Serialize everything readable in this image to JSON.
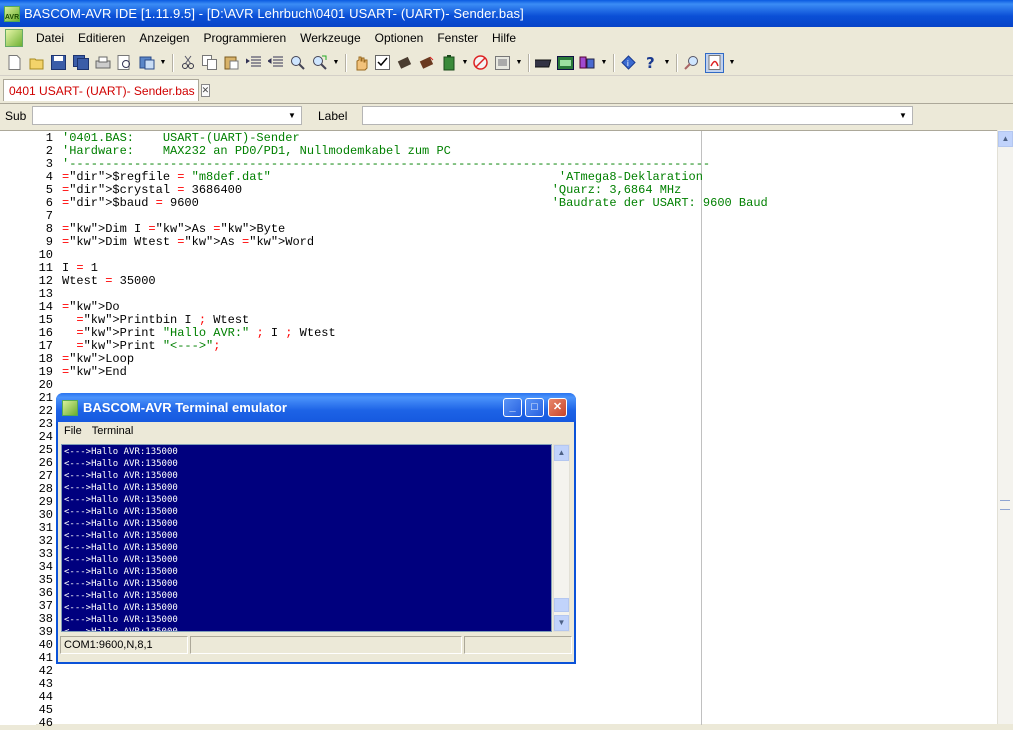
{
  "window": {
    "title": "BASCOM-AVR IDE [1.11.9.5] - [D:\\AVR Lehrbuch\\0401 USART- (UART)- Sender.bas]",
    "app_icon_text": "AVR"
  },
  "menu": [
    "Datei",
    "Editieren",
    "Anzeigen",
    "Programmieren",
    "Werkzeuge",
    "Optionen",
    "Fenster",
    "Hilfe"
  ],
  "toolbar": [
    "new-file-icon",
    "open-file-icon",
    "save-icon",
    "save-all-icon",
    "print-icon",
    "print-preview-icon",
    "compile-icon",
    "dropdown",
    "cut-icon",
    "copy-icon",
    "paste-icon",
    "indent-icon",
    "unindent-icon",
    "find-icon",
    "find-next-icon",
    "dropdown",
    "hand-icon",
    "check-syntax-icon",
    "chip-icon",
    "program-chip-icon",
    "battery-icon",
    "dropdown",
    "stop-icon",
    "simulator-icon",
    "dropdown",
    "lcd-designer-icon",
    "lcd-icon",
    "terminal-icon",
    "dropdown",
    "info-icon",
    "help-icon",
    "dropdown",
    "zoom-icon",
    "pdf-icon",
    "dropdown"
  ],
  "tabs": [
    {
      "label": "0401 USART- (UART)- Sender.bas",
      "active": true
    }
  ],
  "subrow": {
    "sub_label": "Sub",
    "label_label": "Label"
  },
  "code": [
    {
      "n": "1",
      "text": "'0401.BAS:    USART-(UART)-Sender"
    },
    {
      "n": "2",
      "text": "'Hardware:    MAX232 an PD0/PD1, Nullmodemkabel zum PC"
    },
    {
      "n": "3",
      "text": "'-----------------------------------------------------------------------------------------"
    },
    {
      "n": "4",
      "text": "$regfile = \"m8def.dat\"                                        'ATmega8-Deklaration"
    },
    {
      "n": "5",
      "text": "$crystal = 3686400                                           'Quarz: 3,6864 MHz"
    },
    {
      "n": "6",
      "text": "$baud = 9600                                                 'Baudrate der USART: 9600 Baud"
    },
    {
      "n": "7",
      "text": ""
    },
    {
      "n": "8",
      "text": "Dim I As Byte"
    },
    {
      "n": "9",
      "text": "Dim Wtest As Word"
    },
    {
      "n": "10",
      "text": ""
    },
    {
      "n": "11",
      "text": "I = 1"
    },
    {
      "n": "12",
      "text": "Wtest = 35000"
    },
    {
      "n": "13",
      "text": ""
    },
    {
      "n": "14",
      "text": "Do"
    },
    {
      "n": "15",
      "text": "  Printbin I ; Wtest"
    },
    {
      "n": "16",
      "text": "  Print \"Hallo AVR:\" ; I ; Wtest"
    },
    {
      "n": "17",
      "text": "  Print \"<--->\";"
    },
    {
      "n": "18",
      "text": "Loop"
    },
    {
      "n": "19",
      "text": "End"
    },
    {
      "n": "20",
      "text": ""
    },
    {
      "n": "21",
      "text": ""
    },
    {
      "n": "22",
      "text": ""
    },
    {
      "n": "23",
      "text": ""
    },
    {
      "n": "24",
      "text": ""
    },
    {
      "n": "25",
      "text": ""
    },
    {
      "n": "26",
      "text": ""
    },
    {
      "n": "27",
      "text": ""
    },
    {
      "n": "28",
      "text": ""
    },
    {
      "n": "29",
      "text": ""
    },
    {
      "n": "30",
      "text": ""
    },
    {
      "n": "31",
      "text": ""
    },
    {
      "n": "32",
      "text": ""
    },
    {
      "n": "33",
      "text": ""
    },
    {
      "n": "34",
      "text": ""
    },
    {
      "n": "35",
      "text": ""
    },
    {
      "n": "36",
      "text": ""
    },
    {
      "n": "37",
      "text": ""
    },
    {
      "n": "38",
      "text": ""
    },
    {
      "n": "39",
      "text": ""
    },
    {
      "n": "40",
      "text": ""
    },
    {
      "n": "41",
      "text": ""
    },
    {
      "n": "42",
      "text": ""
    },
    {
      "n": "43",
      "text": ""
    },
    {
      "n": "44",
      "text": ""
    },
    {
      "n": "45",
      "text": ""
    },
    {
      "n": "46",
      "text": ""
    }
  ],
  "terminal": {
    "title": "BASCOM-AVR Terminal emulator",
    "menu": [
      "File",
      "Terminal"
    ],
    "lines": [
      "<--->\u0001\u0013Hallo AVR:135000",
      "<--->\u0001\u0013Hallo AVR:135000",
      "<--->\u0001\u0013Hallo AVR:135000",
      "<--->\u0001\u0013Hallo AVR:135000",
      "<--->\u0001\u0013Hallo AVR:135000",
      "<--->\u0001\u0013Hallo AVR:135000",
      "<--->\u0001\u0013Hallo AVR:135000",
      "<--->\u0001\u0013Hallo AVR:135000",
      "<--->\u0001\u0013Hallo AVR:135000",
      "<--->\u0001\u0013Hallo AVR:135000",
      "<--->\u0001\u0013Hallo AVR:135000",
      "<--->\u0001\u0013Hallo AVR:135000",
      "<--->\u0001\u0013Hallo AVR:135000",
      "<--->\u0001\u0013Hallo AVR:135000",
      "<--->\u0001\u0013Hallo AVR:135000",
      "<--->\u0001\u0013Hallo AVR:135000"
    ],
    "status": "COM1:9600,N,8,1"
  }
}
